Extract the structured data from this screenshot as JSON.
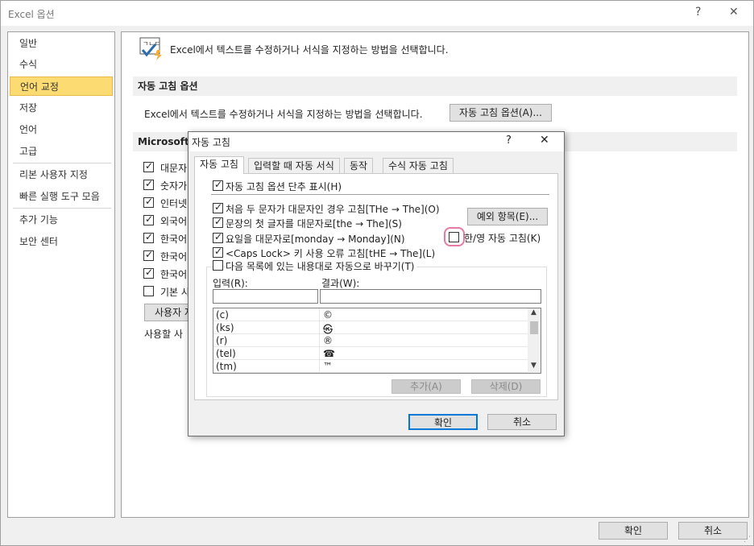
{
  "window": {
    "title": "Excel 옵션",
    "help": "?",
    "close": "✕"
  },
  "sidebar": {
    "items": [
      {
        "label": "일반"
      },
      {
        "label": "수식"
      },
      {
        "label": "언어 교정"
      },
      {
        "label": "저장"
      },
      {
        "label": "언어"
      },
      {
        "label": "고급"
      },
      {
        "label": "리본 사용자 지정"
      },
      {
        "label": "빠른 실행 도구 모음"
      },
      {
        "label": "추가 기능"
      },
      {
        "label": "보안 센터"
      }
    ]
  },
  "main": {
    "intro": "Excel에서 텍스트를 수정하거나 서식을 지정하는 방법을 선택합니다.",
    "autocorrect_section": "자동 고침 옵션",
    "autocorrect_desc": "Excel에서 텍스트를 수정하거나 서식을 지정하는 방법을 선택합니다.",
    "autocorrect_button": "자동 고침 옵션(A)...",
    "office_section": "Microsoft O",
    "office_checks": [
      {
        "label": "대문자",
        "checked": true
      },
      {
        "label": "숫자가",
        "checked": true
      },
      {
        "label": "인터넷",
        "checked": true
      },
      {
        "label": "외국어",
        "checked": true
      },
      {
        "label": "한국어",
        "checked": true
      },
      {
        "label": "한국어",
        "checked": true
      },
      {
        "label": "한국어",
        "checked": true
      },
      {
        "label": "기본 사",
        "checked": false
      }
    ],
    "custom_dict_button": "사용자 지",
    "custom_dict_desc": "사용할 사"
  },
  "footer": {
    "ok": "확인",
    "cancel": "취소"
  },
  "dialog": {
    "title": "자동 고침",
    "help": "?",
    "close": "✕",
    "tabs": [
      {
        "label": "자동 고침"
      },
      {
        "label": "입력할 때 자동 서식"
      },
      {
        "label": "동작"
      },
      {
        "label": "수식 자동 고침"
      }
    ],
    "show_buttons": "자동 고침 옵션 단추 표시(H)",
    "options": [
      {
        "label": "처음 두 문자가 대문자인 경우 고침[THe → The](O)",
        "checked": true
      },
      {
        "label": "문장의 첫 글자를 대문자로[the → The](S)",
        "checked": true
      },
      {
        "label": "요일을 대문자로[monday → Monday](N)",
        "checked": true
      },
      {
        "label": "<Caps Lock> 키 사용 오류 고침[tHE → The](L)",
        "checked": true
      },
      {
        "label": "다음 목록에 있는 내용대로 자동으로 바꾸기(T)",
        "checked": false
      }
    ],
    "exceptions_button": "예외 항목(E)...",
    "hanyoung_label": "한/영 자동 고침(K)",
    "input_label": "입력(R):",
    "result_label": "결과(W):",
    "entries": [
      {
        "input": "(c)",
        "result": "©"
      },
      {
        "input": "(ks)",
        "result": "㉿"
      },
      {
        "input": "(r)",
        "result": "®"
      },
      {
        "input": "(tel)",
        "result": "☎"
      },
      {
        "input": "(tm)",
        "result": "™"
      }
    ],
    "add_button": "추가(A)",
    "delete_button": "삭제(D)",
    "ok": "확인",
    "cancel": "취소"
  },
  "colors": {
    "selected_bg": "#fcdc72",
    "focus_ring": "#e57aa3",
    "primary_border": "#0078d7"
  }
}
